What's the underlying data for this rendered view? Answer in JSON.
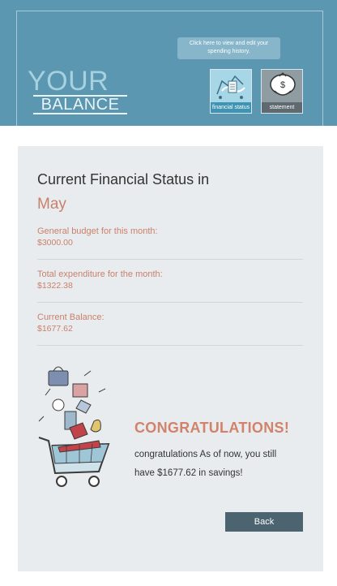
{
  "header": {
    "tooltip_line1": "Click here to view and edit your",
    "tooltip_line2": "spending history.",
    "logo_top": "YOUR",
    "logo_bottom": "BALANCE",
    "nav_financial_label": "financial status",
    "nav_financial_icon": "shopping-receipt-icon",
    "nav_statement_label": "statement",
    "nav_statement_icon": "money-bag-icon"
  },
  "status": {
    "title": "Current Financial Status in",
    "month": "May",
    "budget_label": "General budget for this month:",
    "budget_value": "$3000.00",
    "expenditure_label": "Total expenditure for the month:",
    "expenditure_value": "$1322.38",
    "balance_label": "Current Balance:",
    "balance_value": "$1677.62"
  },
  "congrats": {
    "heading": "CONGRATULATIONS!",
    "message": "congratulations As of now, you still have $1677.62 in savings!",
    "illustration_icon": "shopping-cart-illustration"
  },
  "actions": {
    "back_label": "Back"
  },
  "colors": {
    "header_bg": "#5b97b1",
    "card_bg": "#e9ecee",
    "accent": "#c9806b",
    "button_bg": "#4b6470"
  }
}
